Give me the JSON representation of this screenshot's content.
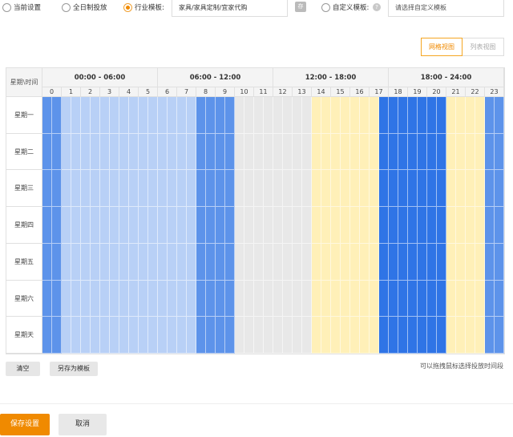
{
  "schedule_options": {
    "current": "当前设置",
    "all_day": "全日制投放",
    "industry_template": "行业模板:",
    "industry_value": "家具/家具定制/宜家代购",
    "save_icon_glyph": "存",
    "custom_template": "自定义模板:",
    "help_glyph": "?",
    "custom_placeholder": "请选择自定义模板",
    "selected": "industry_template"
  },
  "view_toggle": {
    "grid": "网格视图",
    "list": "列表视图",
    "active": "grid"
  },
  "schedule_grid": {
    "corner_label": "星期\\时间",
    "groups": [
      "00:00 - 06:00",
      "06:00 - 12:00",
      "12:00 - 18:00",
      "18:00 - 24:00"
    ],
    "hours": [
      "0",
      "1",
      "2",
      "3",
      "4",
      "5",
      "6",
      "7",
      "8",
      "9",
      "10",
      "11",
      "12",
      "13",
      "14",
      "15",
      "16",
      "17",
      "18",
      "19",
      "20",
      "21",
      "22",
      "23"
    ],
    "days": [
      "星期一",
      "星期二",
      "星期三",
      "星期四",
      "星期五",
      "星期六",
      "星期天"
    ],
    "half_hour_levels": [
      1,
      1,
      2,
      2,
      2,
      2,
      2,
      2,
      2,
      2,
      2,
      2,
      2,
      2,
      2,
      2,
      1,
      1,
      1,
      1,
      0,
      0,
      0,
      0,
      0,
      0,
      0,
      0,
      3,
      3,
      3,
      3,
      3,
      3,
      3,
      3,
      3,
      3,
      3,
      3,
      3,
      3,
      3,
      3,
      3,
      3,
      3,
      3
    ],
    "level_colors": {
      "0": "#e8e8e8",
      "1": "#5d93ea",
      "2": "#b8d0f6",
      "3": "#fff0b8",
      "4": "#2f74e6"
    },
    "override": {
      "hours_18_20": 4,
      "hour_17_second_half": 4,
      "hours_21_22": 3,
      "hour_23_first_half": 1
    }
  },
  "actions": {
    "clear": "清空",
    "save_as_template": "另存为模板",
    "hint": "可以拖拽鼠标选择投放时间段",
    "save_settings": "保存设置",
    "cancel": "取消"
  }
}
